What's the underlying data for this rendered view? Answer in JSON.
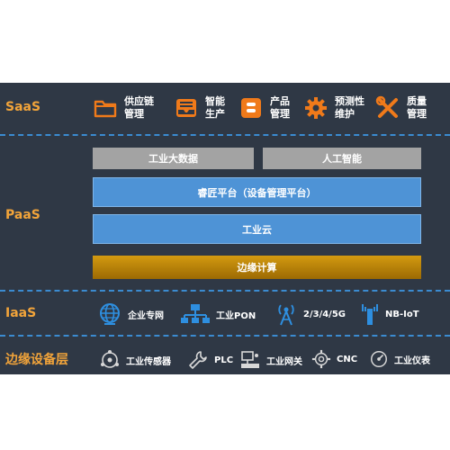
{
  "layers": {
    "saas": "SaaS",
    "paas": "PaaS",
    "iaas": "IaaS",
    "edge": "边缘设备层"
  },
  "saas_items": [
    {
      "label": "供应链\n管理",
      "icon": "folder-icon"
    },
    {
      "label": "智能\n生产",
      "icon": "inbox-tray-icon"
    },
    {
      "label": "产品\n管理",
      "icon": "blogger-b-icon"
    },
    {
      "label": "预测性\n维护",
      "icon": "gear-icon"
    },
    {
      "label": "质量\n管理",
      "icon": "wrench-screwdriver-icon"
    }
  ],
  "paas": {
    "big_data": "工业大数据",
    "ai": "人工智能",
    "platform": "睿匠平台（设备管理平台）",
    "cloud": "工业云",
    "edge_computing": "边缘计算"
  },
  "iaas_items": [
    {
      "label": "企业专网",
      "icon": "globe-icon"
    },
    {
      "label": "工业PON",
      "icon": "network-topology-icon"
    },
    {
      "label": "2/3/4/5G",
      "icon": "signal-tower-icon"
    },
    {
      "label": "NB-IoT",
      "icon": "antenna-icon"
    }
  ],
  "edge_items": [
    {
      "label": "工业传感器",
      "icon": "sensor-icon"
    },
    {
      "label": "PLC",
      "icon": "wrench-icon"
    },
    {
      "label": "工业网关",
      "icon": "gateway-icon"
    },
    {
      "label": "CNC",
      "icon": "gear-outline-icon"
    },
    {
      "label": "工业仪表",
      "icon": "gauge-icon"
    }
  ],
  "colors": {
    "panel": "#2f3845",
    "accent": "#f2a43a",
    "divider": "#3b8bd0",
    "blue_bar": "#4e93d6",
    "gray_bar": "#a3a3a3",
    "gold_bar": "#c28a0c",
    "icon_blue": "#2e8fe0",
    "icon_orange": "#f07a1a"
  }
}
